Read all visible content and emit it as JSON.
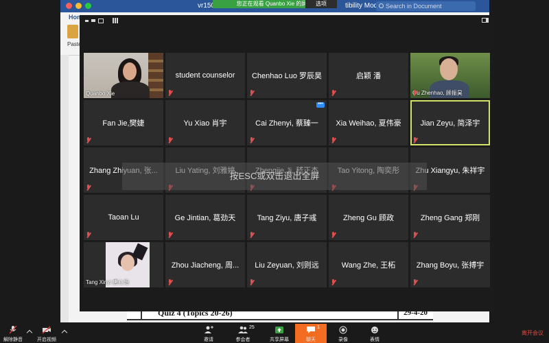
{
  "word": {
    "doc_name": "vr150...",
    "doc_name_right": "tibility Mod...",
    "search_placeholder": "Search in Document",
    "home_tab": "Hom",
    "paste_label": "Paste",
    "quiz_title": "Quiz 4 (Topics 20-26)",
    "quiz_date": "29-4-20"
  },
  "zoom": {
    "banner": "您正在观看 Quanbo Xie 的屏幕",
    "options_label": "选项",
    "esc_hint": "按ESC或双击退出全屏",
    "participants": [
      {
        "name": "Quanbo Xie",
        "video": true
      },
      {
        "name": "student counselor"
      },
      {
        "name": "Chenhao Luo 罗辰昊"
      },
      {
        "name": "启颖 潘"
      },
      {
        "name": "Gu Zhenhao, 顾振昊",
        "video": true
      },
      {
        "name": "Fan Jie,樊婕"
      },
      {
        "name": "Yu Xiao 肖宇"
      },
      {
        "name": "Cai Zhenyi, 蔡臻一"
      },
      {
        "name": "Xia Weihao, 夏伟豪"
      },
      {
        "name": "Jian Zeyu, 简泽宇",
        "active": true
      },
      {
        "name": "Zhang Zhiyuan, 张..."
      },
      {
        "name": "Liu Yating, 刘雅婷"
      },
      {
        "name": "Zhengjie Ji, 嵇正杰"
      },
      {
        "name": "Tao Yitong, 陶奕彤"
      },
      {
        "name": "Zhu Xiangyu, 朱祥宇"
      },
      {
        "name": "Taoan Lu"
      },
      {
        "name": "Ge Jintian, 葛劲天"
      },
      {
        "name": "Tang Ziyu, 唐子彧"
      },
      {
        "name": "Zheng Gu 顾政"
      },
      {
        "name": "Zheng Gang 郑刚"
      },
      {
        "name": "Tang Xinyi 唐心怡",
        "video": true
      },
      {
        "name": "Zhou Jiacheng, 周..."
      },
      {
        "name": "Liu Zeyuan, 刘则远"
      },
      {
        "name": "Wang Zhe, 王柘"
      },
      {
        "name": "Zhang Boyu, 张搏宇"
      }
    ],
    "toolbar": {
      "unmute": "解除静音",
      "start_video": "开启视频",
      "invite": "邀请",
      "participants": "参会者",
      "participants_count": "25",
      "share": "共享屏幕",
      "chat": "聊天",
      "chat_count": "1",
      "record": "录像",
      "reactions": "表情",
      "leave": "离开会议"
    },
    "colors": {
      "banner_green": "#3aa142",
      "active_border": "#d6e36b",
      "chat_orange": "#f26d21",
      "leave_red": "#e8473f"
    }
  }
}
